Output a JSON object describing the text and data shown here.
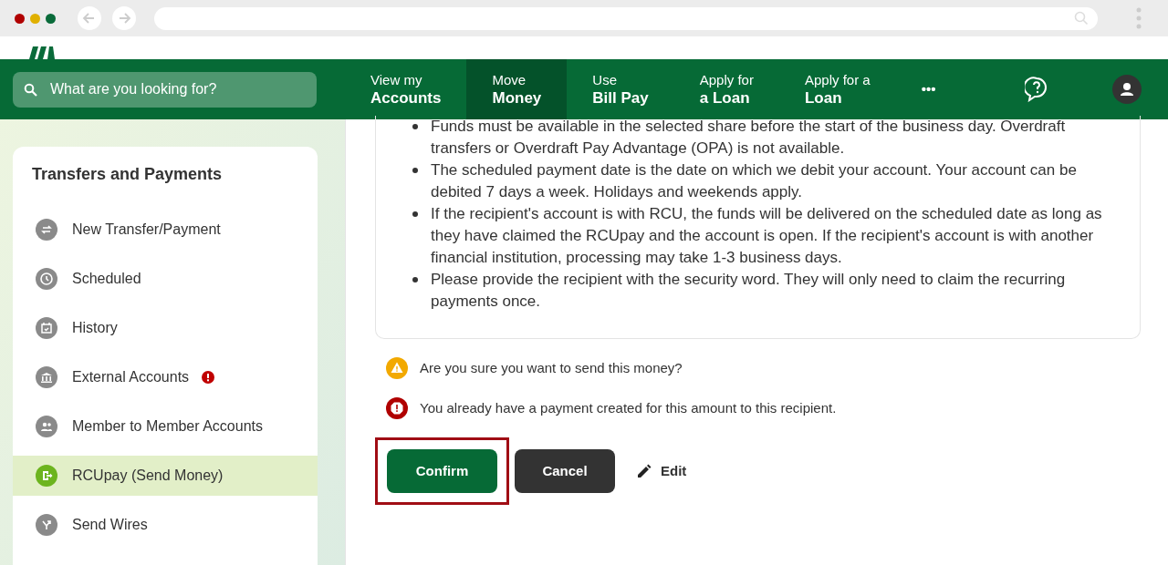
{
  "search": {
    "placeholder": "What are you looking for?"
  },
  "nav": [
    {
      "line1": "View my",
      "line2": "Accounts",
      "selected": false
    },
    {
      "line1": "Move",
      "line2": "Money",
      "selected": true
    },
    {
      "line1": "Use",
      "line2": "Bill Pay",
      "selected": false
    },
    {
      "line1": "Apply for",
      "line2": "a Loan",
      "selected": false
    },
    {
      "line1": "Apply for a",
      "line2": "Loan",
      "selected": false
    }
  ],
  "more": "•••",
  "sidebar": {
    "title": "Transfers and Payments",
    "items": [
      {
        "label": "New Transfer/Payment",
        "selected": false,
        "alert": false
      },
      {
        "label": "Scheduled",
        "selected": false,
        "alert": false
      },
      {
        "label": "History",
        "selected": false,
        "alert": false
      },
      {
        "label": "External Accounts",
        "selected": false,
        "alert": true
      },
      {
        "label": "Member to Member Accounts",
        "selected": false,
        "alert": false
      },
      {
        "label": "RCUpay (Send Money)",
        "selected": true,
        "alert": false
      },
      {
        "label": "Send Wires",
        "selected": false,
        "alert": false
      }
    ]
  },
  "notes": [
    "Funds must be available in the selected share before the start of the business day. Overdraft transfers or Overdraft Pay Advantage (OPA) is not available.",
    "The scheduled payment date is the date on which we debit your account. Your account can be debited 7 days a week. Holidays and weekends apply.",
    "If the recipient's account is with RCU, the funds will be delivered on the scheduled date as long as they have claimed the RCUpay and the account is open. If the recipient's account is with another financial institution, processing may take 1-3 business days.",
    "Please provide the recipient with the security word. They will only need to claim the recurring payments once."
  ],
  "messages": [
    {
      "kind": "warning",
      "text": "Are you sure you want to send this money?"
    },
    {
      "kind": "error",
      "text": "You already have a payment created for this amount to this recipient."
    }
  ],
  "actions": {
    "confirm": "Confirm",
    "cancel": "Cancel",
    "edit": "Edit"
  }
}
